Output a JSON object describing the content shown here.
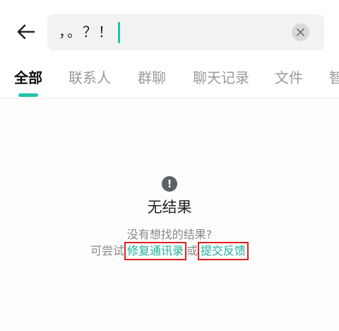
{
  "search": {
    "query": "，。？！"
  },
  "tabs": [
    {
      "label": "全部"
    },
    {
      "label": "联系人"
    },
    {
      "label": "群聊"
    },
    {
      "label": "聊天记录"
    },
    {
      "label": "文件"
    },
    {
      "label": "智"
    }
  ],
  "empty_state": {
    "title": "无结果",
    "hint": "没有想找的结果?",
    "prefix": "可尝试",
    "repair_link": "修复通讯录",
    "connector": "或",
    "feedback_link": "提交反馈"
  },
  "colors": {
    "accent": "#21c4a4",
    "link": "#1ab39a",
    "highlight_border": "#e02020"
  },
  "icons": {
    "back": "arrow-left-icon",
    "clear": "close-circle-icon",
    "alert": "exclamation-circle-icon"
  }
}
